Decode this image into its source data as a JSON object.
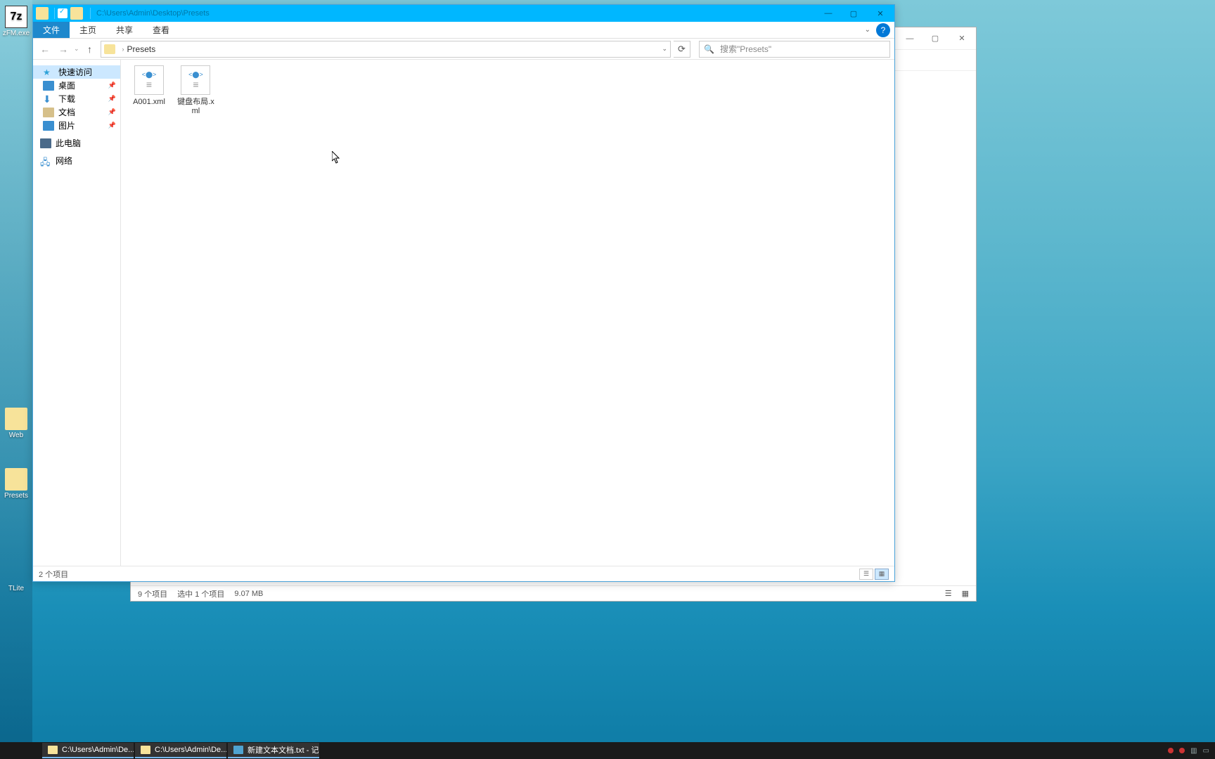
{
  "desktop_icons": {
    "sevenz": "zFM.exe",
    "web": "Web",
    "presets": "Presets",
    "ntlite": "TLite"
  },
  "window": {
    "title_path": "C:\\Users\\Admin\\Desktop\\Presets",
    "tabs": {
      "file": "文件",
      "home": "主页",
      "share": "共享",
      "view": "查看"
    },
    "breadcrumb": "Presets",
    "search_placeholder": "搜索\"Presets\"",
    "sidebar": {
      "quick": "快速访问",
      "desktop": "桌面",
      "downloads": "下载",
      "documents": "文档",
      "pictures": "图片",
      "thispc": "此电脑",
      "network": "网络"
    },
    "files": [
      {
        "name": "A001.xml"
      },
      {
        "name": "键盘布局.xml"
      }
    ],
    "status": "2 个项目"
  },
  "window2": {
    "status_count": "9 个项目",
    "status_selected": "选中 1 个项目",
    "status_size": "9.07 MB"
  },
  "taskbar": {
    "task1": "C:\\Users\\Admin\\De...",
    "task2": "C:\\Users\\Admin\\De...",
    "task3": "新建文本文档.txt - 记..."
  }
}
